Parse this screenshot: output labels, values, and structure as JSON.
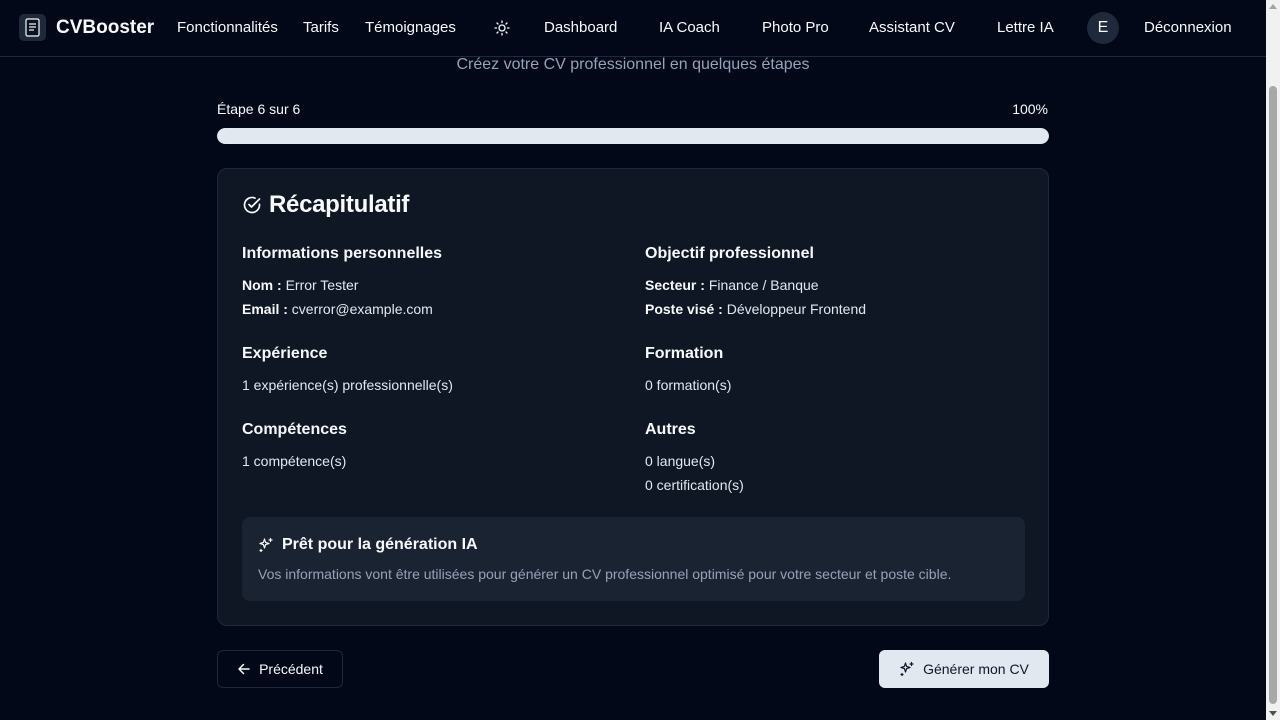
{
  "header": {
    "brand": "CVBooster",
    "nav": {
      "features": "Fonctionnalités",
      "pricing": "Tarifs",
      "testimonials": "Témoignages",
      "dashboard": "Dashboard",
      "ia_coach": "IA Coach",
      "photo_pro": "Photo Pro",
      "assistant_cv": "Assistant CV",
      "lettre_ia": "Lettre IA",
      "logout": "Déconnexion"
    },
    "avatar_initial": "E",
    "theme_icon": "sun-icon"
  },
  "wizard": {
    "subtitle": "Créez votre CV professionnel en quelques étapes",
    "step_label": "Étape 6 sur 6",
    "progress_text": "100%",
    "progress_value": 1.0
  },
  "summary": {
    "title": "Récapitulatif",
    "personal": {
      "heading": "Informations personnelles",
      "name_label": "Nom :",
      "name_value": "Error Tester",
      "email_label": "Email :",
      "email_value": "cverror@example.com"
    },
    "objective": {
      "heading": "Objectif professionnel",
      "sector_label": "Secteur :",
      "sector_value": "Finance / Banque",
      "position_label": "Poste visé :",
      "position_value": "Développeur Frontend"
    },
    "experience": {
      "heading": "Expérience",
      "text": "1 expérience(s) professionnelle(s)"
    },
    "education": {
      "heading": "Formation",
      "text": "0 formation(s)"
    },
    "skills": {
      "heading": "Compétences",
      "text": "1 compétence(s)"
    },
    "others": {
      "heading": "Autres",
      "languages": "0 langue(s)",
      "certifications": "0 certification(s)"
    },
    "ai": {
      "heading": "Prêt pour la génération IA",
      "description": "Vos informations vont être utilisées pour générer un CV professionnel optimisé pour votre secteur et poste cible."
    }
  },
  "actions": {
    "previous": "Précédent",
    "generate": "Générer mon CV"
  }
}
